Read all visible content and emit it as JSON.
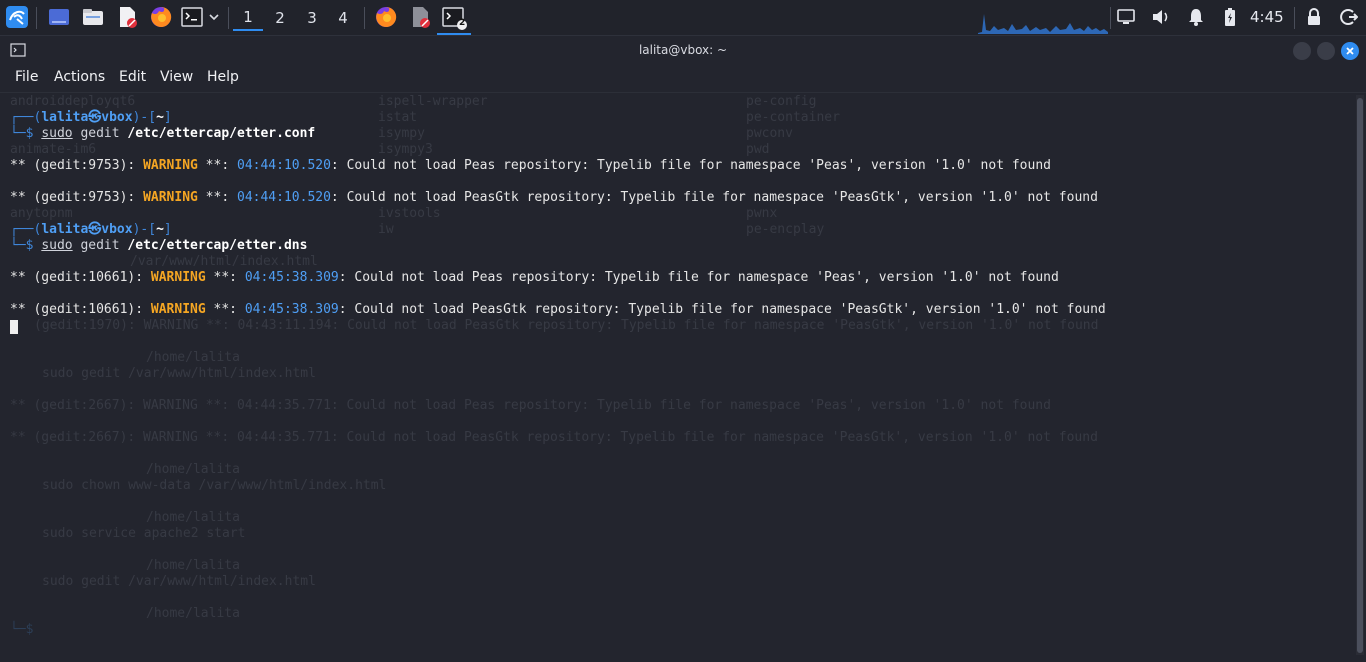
{
  "panel": {
    "workspaces": [
      "1",
      "2",
      "3",
      "4"
    ],
    "active_workspace": "1",
    "terminal_badge": "2",
    "clock": "4:45"
  },
  "window": {
    "title": "lalita@vbox: ~",
    "menu": [
      "File",
      "Actions",
      "Edit",
      "View",
      "Help"
    ]
  },
  "terminal": {
    "prompt1": {
      "frame_open": "┌──(",
      "user": "lalita㉿vbox",
      "frame_close": ")-[",
      "dir": "~",
      "end": "]",
      "cmd_prefix": "└─$ ",
      "sudo": "sudo",
      "cmd": " gedit ",
      "arg": "/etc/ettercap/etter.conf"
    },
    "out1a": {
      "pre": "** (gedit:9753): ",
      "warn": "WARNING",
      "mid": " **: ",
      "ts": "04:44:10.520",
      "msg": ": Could not load Peas repository: Typelib file for namespace 'Peas', version '1.0' not found"
    },
    "out1b": {
      "pre": "** (gedit:9753): ",
      "warn": "WARNING",
      "mid": " **: ",
      "ts": "04:44:10.520",
      "msg": ": Could not load PeasGtk repository: Typelib file for namespace 'PeasGtk', version '1.0' not found"
    },
    "prompt2": {
      "frame_open": "┌──(",
      "user": "lalita㉿vbox",
      "frame_close": ")-[",
      "dir": "~",
      "end": "]",
      "cmd_prefix": "└─$ ",
      "sudo": "sudo",
      "cmd": " gedit ",
      "arg": "/etc/ettercap/etter.dns"
    },
    "out2a": {
      "pre": "** (gedit:10661): ",
      "warn": "WARNING",
      "mid": " **: ",
      "ts": "04:45:38.309",
      "msg": ": Could not load Peas repository: Typelib file for namespace 'Peas', version '1.0' not found"
    },
    "out2b": {
      "pre": "** (gedit:10661): ",
      "warn": "WARNING",
      "mid": " **: ",
      "ts": "04:45:38.309",
      "msg": ": Could not load PeasGtk repository: Typelib file for namespace 'PeasGtk', version '1.0' not found"
    }
  },
  "ghost": {
    "c1": [
      "androiddeployqt6",
      "",
      "",
      "animate-im6",
      "",
      "",
      "",
      "anytopnm"
    ],
    "c2": [
      "ispell-wrapper",
      "istat",
      "isympy",
      "isympy3",
      "",
      "",
      "ivstools",
      "iw"
    ],
    "c3": [
      "pe-config",
      "pe-container",
      "pwconv",
      "pwd",
      "",
      "",
      "pwnx",
      "pe-encplay"
    ],
    "r1": "/var/www/html/index.html",
    "r2": "(gedit:1970): WARNING **: 04:43:11.194: Could not load PeasGtk repository: Typelib file for namespace 'PeasGtk', version '1.0' not found",
    "r3": "/home/lalita",
    "r4": "sudo gedit /var/www/html/index.html",
    "r5": "** (gedit:2667): WARNING **: 04:44:35.771: Could not load Peas repository: Typelib file for namespace 'Peas', version '1.0' not found",
    "r6": "** (gedit:2667): WARNING **: 04:44:35.771: Could not load PeasGtk repository: Typelib file for namespace 'PeasGtk', version '1.0' not found",
    "r7": "/home/lalita",
    "r8": "sudo chown www-data /var/www/html/index.html",
    "r9": "/home/lalita",
    "r10": "sudo service apache2 start",
    "r11": "/home/lalita",
    "r12": "sudo gedit /var/www/html/index.html",
    "r13": "/home/lalita",
    "r14": "└─$ "
  }
}
